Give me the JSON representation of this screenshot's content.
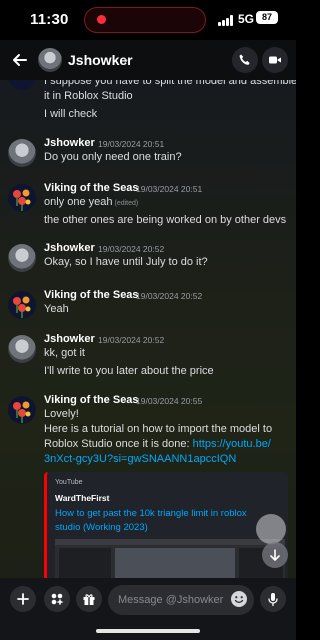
{
  "status_bar": {
    "time": "11:30",
    "network": "5G",
    "battery": "87"
  },
  "header": {
    "contact_name": "Jshowker",
    "chevron": "›"
  },
  "messages": [
    {
      "lines": [
        "I suppose you have to split the model and assemble",
        "it in Roblox Studio"
      ]
    },
    {
      "lines": [
        "I will check"
      ]
    },
    {
      "author": "Jshowker",
      "timestamp": "19/03/2024 20:51",
      "lines": [
        "Do you only need one train?"
      ]
    },
    {
      "author": "Viking of the Seas",
      "timestamp": "19/03/2024 20:51",
      "lines": [
        "only one yeah",
        "the other ones are being worked on by other devs"
      ],
      "edited_label": "(edited)"
    },
    {
      "author": "Jshowker",
      "timestamp": "19/03/2024 20:52",
      "lines": [
        "Okay, so I have until July to do it?"
      ]
    },
    {
      "author": "Viking of the Seas",
      "timestamp": "19/03/2024 20:52",
      "lines": [
        "Yeah"
      ]
    },
    {
      "author": "Jshowker",
      "timestamp": "19/03/2024 20:52",
      "lines": [
        "kk, got it",
        "I'll write to you later about the price"
      ]
    },
    {
      "author": "Viking of the Seas",
      "timestamp": "19/03/2024 20:55",
      "lines": [
        "Lovely!",
        "Here is a tutorial on how to import the model to",
        "Roblox Studio once it is done: ",
        "3nXct-gcy3U?si=gwSNAANN1apccIQN"
      ],
      "link_part1": "https://youtu.be/"
    }
  ],
  "embed": {
    "provider": "YouTube",
    "author": "WardTheFirst",
    "title_line1": "How to get past the 10k triangle limit in roblox",
    "title_line2": "studio (Working 2023)"
  },
  "composer": {
    "placeholder": "Message @Jshowker"
  },
  "colors": {
    "link": "#00a8fc",
    "embed_accent": "#ff0000",
    "recording_dot": "#ff2d3b"
  },
  "icons": [
    "back-arrow-icon",
    "phone-icon",
    "video-camera-icon",
    "plus-icon",
    "apps-icon",
    "gift-icon",
    "emoji-icon",
    "microphone-icon",
    "arrow-down-icon"
  ]
}
